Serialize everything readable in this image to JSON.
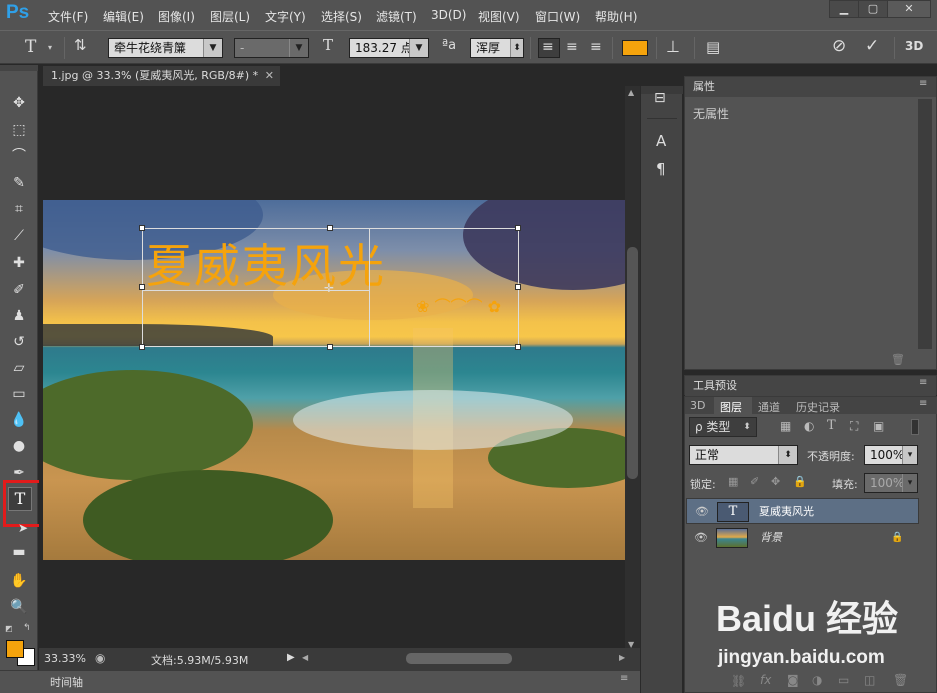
{
  "app": {
    "logo": "Ps"
  },
  "menu": [
    "文件(F)",
    "编辑(E)",
    "图像(I)",
    "图层(L)",
    "文字(Y)",
    "选择(S)",
    "滤镜(T)",
    "3D(D)",
    "视图(V)",
    "窗口(W)",
    "帮助(H)"
  ],
  "options": {
    "font_family": "牵牛花绕青簾",
    "font_style": "-",
    "font_size": "183.27 点",
    "aa_label": "ªa",
    "antialias": "浑厚",
    "text_color": "#f5a30c"
  },
  "document": {
    "tab_title": "1.jpg @ 33.3% (夏威夷风光, RGB/8#) *",
    "text_layer_content": "夏威夷风光",
    "zoom": "33.33%",
    "doc_info": "文档:5.93M/5.93M"
  },
  "timeline": {
    "label": "时间轴"
  },
  "properties": {
    "title": "属性",
    "empty": "无属性"
  },
  "tool_presets": {
    "title": "工具预设"
  },
  "layers_panel": {
    "tabs": [
      "3D",
      "图层",
      "通道",
      "历史记录"
    ],
    "active_tab": "图层",
    "filter_label": "ρ 类型",
    "blend_mode": "正常",
    "opacity_label": "不透明度:",
    "opacity_value": "100%",
    "lock_label": "锁定:",
    "fill_label": "填充:",
    "fill_value": "100%",
    "layers": [
      {
        "name": "夏威夷风光",
        "type": "text",
        "selected": true
      },
      {
        "name": "背景",
        "type": "image",
        "locked": true
      }
    ]
  },
  "watermark": {
    "brand": "Baidu 经验",
    "url": "jingyan.baidu.com"
  },
  "colors": {
    "foreground": "#f5a30c",
    "background": "#ffffff",
    "highlight": "#e21b1b"
  }
}
